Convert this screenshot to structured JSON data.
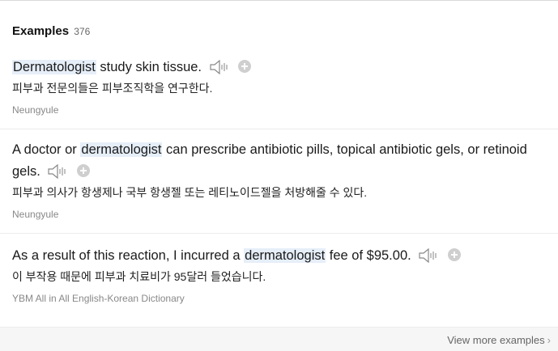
{
  "header": {
    "title": "Examples",
    "count": "376"
  },
  "examples": [
    {
      "en_pre": "",
      "en_hl": "Dermatologist",
      "en_post": " study skin tissue.",
      "ko": "피부과 전문의들은 피부조직학을 연구한다.",
      "source": "Neungyule"
    },
    {
      "en_pre": "A doctor or ",
      "en_hl": "dermatologist",
      "en_post": " can prescribe antibiotic pills, topical antibiotic gels, or retinoid gels.",
      "ko": "피부과 의사가 항생제나 국부 항생젤 또는 레티노이드젤을 처방해줄 수 있다.",
      "source": "Neungyule"
    },
    {
      "en_pre": "As a result of this reaction, I incurred a ",
      "en_hl": "dermatologist",
      "en_post": " fee of $95.00.",
      "ko": "이 부작용 때문에 피부과 치료비가 95달러 들었습니다.",
      "source": "YBM All in All English-Korean Dictionary"
    }
  ],
  "footer": {
    "more_label": "View more examples",
    "chevron": "›"
  },
  "icons": {
    "speaker": "speaker-icon",
    "add": "add-circle-icon"
  },
  "colors": {
    "highlight": "#e6eef8",
    "source_text": "#888888",
    "icon_gray": "#cfcfcf"
  }
}
